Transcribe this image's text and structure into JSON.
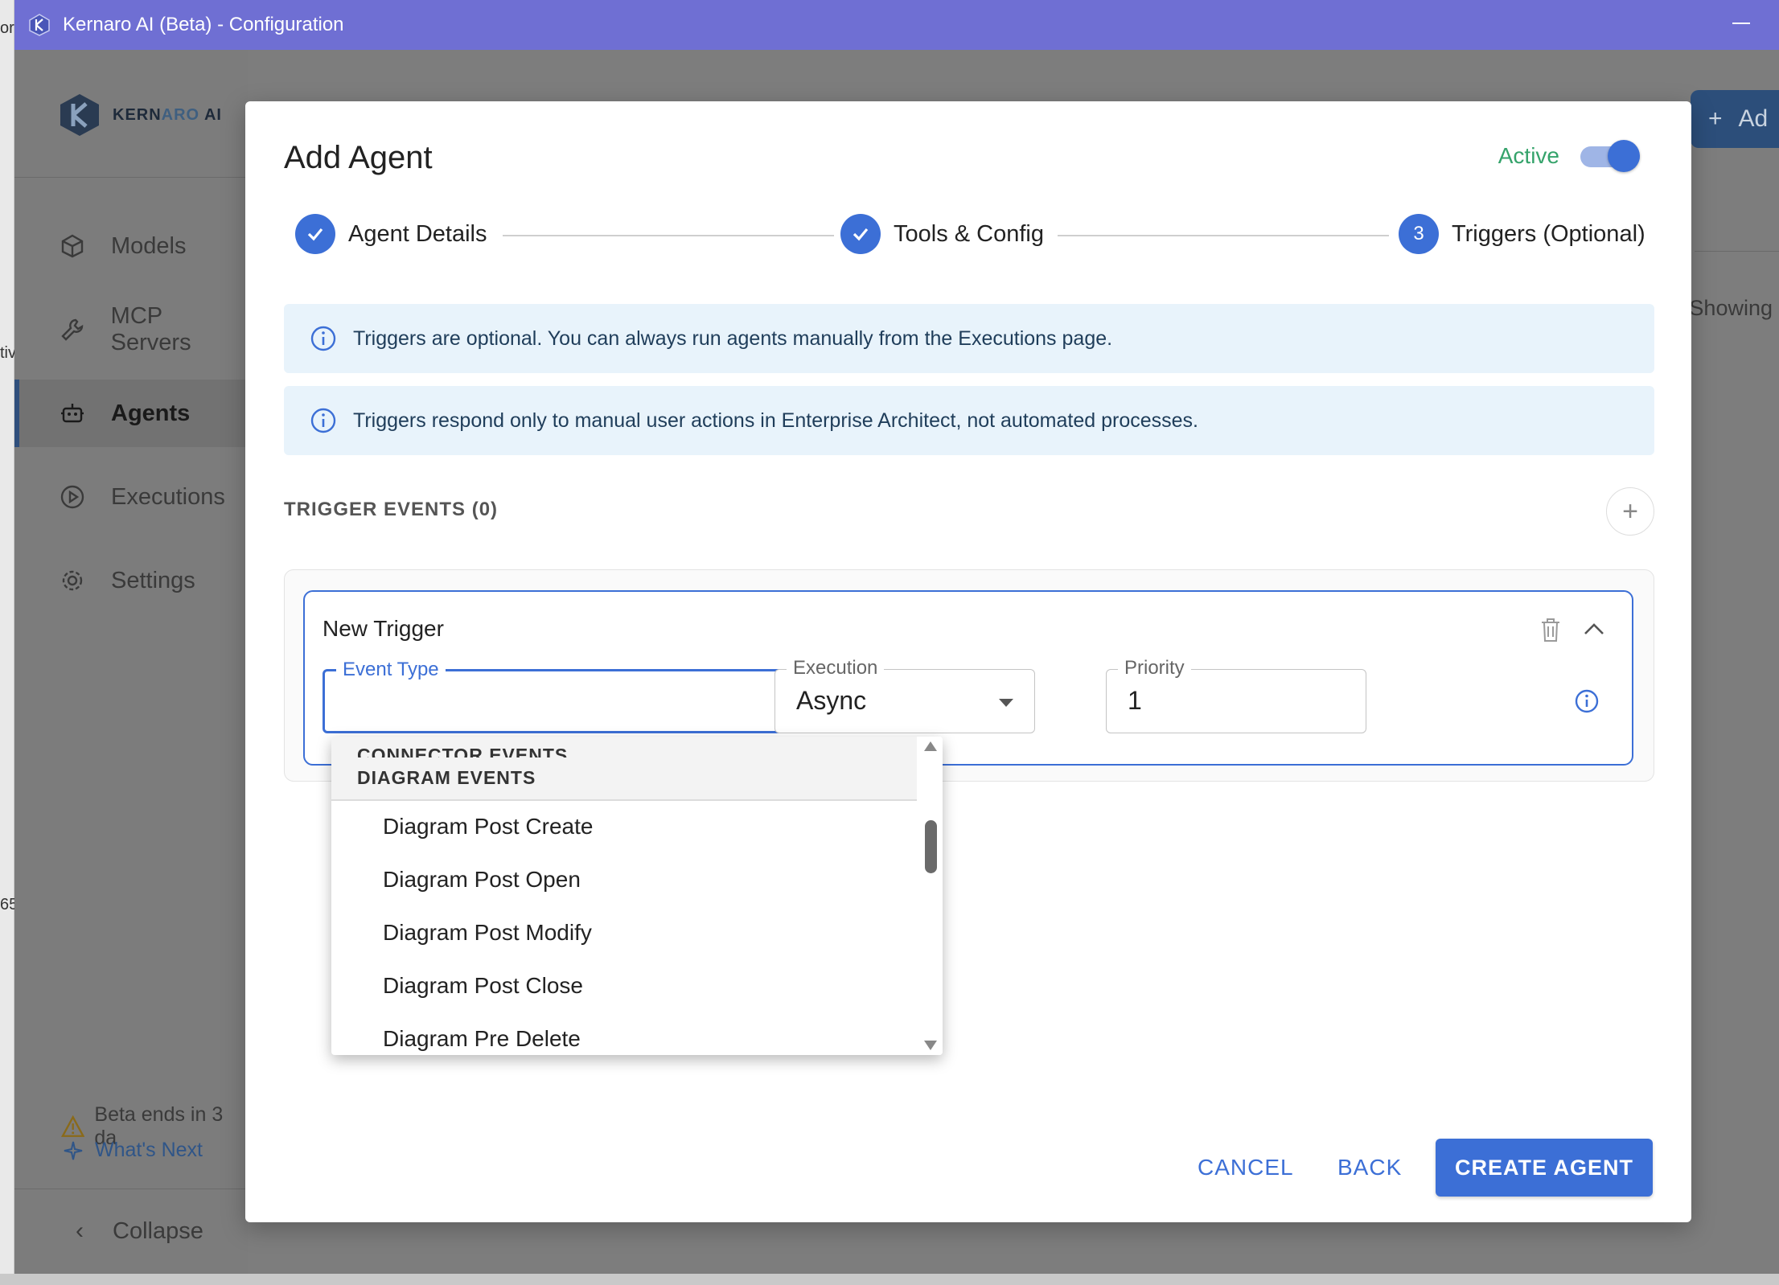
{
  "window": {
    "title": "Kernaro AI (Beta) - Configuration"
  },
  "edge_fragments": [
    "or",
    "tiv",
    "65"
  ],
  "sidebar": {
    "brand_prefix": "KERN",
    "brand_mid": "ARO",
    "brand_suffix": "AI",
    "items": [
      {
        "label": "Models",
        "icon": "cube-icon"
      },
      {
        "label": "MCP Servers",
        "icon": "wrench-icon"
      },
      {
        "label": "Agents",
        "icon": "robot-icon",
        "active": true
      },
      {
        "label": "Executions",
        "icon": "play-circle-icon"
      },
      {
        "label": "Settings",
        "icon": "gear-icon"
      }
    ],
    "beta_notice": "Beta ends in 3 da",
    "whats_next": "What's Next",
    "collapse": "Collapse"
  },
  "background": {
    "add_button": "Ad",
    "showing_text": "Showing"
  },
  "modal": {
    "title": "Add Agent",
    "active_label": "Active",
    "active": true,
    "steps": [
      {
        "label": "Agent Details",
        "state": "complete"
      },
      {
        "label": "Tools & Config",
        "state": "complete"
      },
      {
        "label": "Triggers (Optional)",
        "state": "current",
        "number": "3"
      }
    ],
    "info_messages": [
      "Triggers are optional. You can always run agents manually from the Executions page.",
      "Triggers respond only to manual user actions in Enterprise Architect, not automated processes."
    ],
    "trigger_heading": "TRIGGER EVENTS (0)",
    "trigger": {
      "name": "New Trigger",
      "event_type_label": "Event Type",
      "event_type_value": "",
      "execution_label": "Execution",
      "execution_value": "Async",
      "priority_label": "Priority",
      "priority_value": "1"
    },
    "dropdown": {
      "groups": [
        "CONNECTOR EVENTS",
        "DIAGRAM EVENTS"
      ],
      "items": [
        "Diagram Post Create",
        "Diagram Post Open",
        "Diagram Post Modify",
        "Diagram Post Close",
        "Diagram Pre Delete"
      ]
    },
    "buttons": {
      "cancel": "CANCEL",
      "back": "BACK",
      "create": "CREATE AGENT"
    }
  },
  "colors": {
    "titlebar": "#6f6fd3",
    "primary": "#3c6fd6",
    "active_green": "#35a36b",
    "info_bg": "#e8f3fb"
  }
}
